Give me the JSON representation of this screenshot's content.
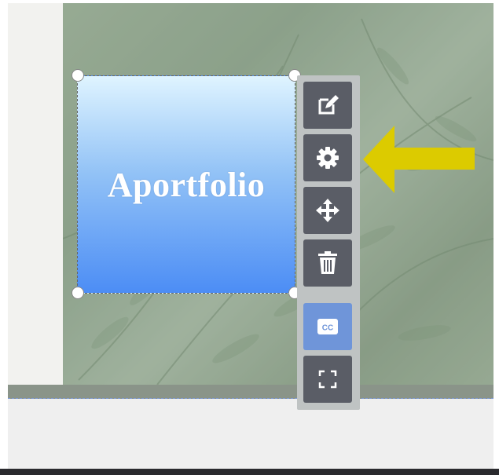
{
  "block": {
    "title": "Aportfolio"
  },
  "toolbar": {
    "tools": [
      {
        "name": "edit",
        "icon": "edit-icon"
      },
      {
        "name": "settings",
        "icon": "gear-icon"
      },
      {
        "name": "move",
        "icon": "move-icon"
      },
      {
        "name": "delete",
        "icon": "trash-icon"
      }
    ],
    "secondary": [
      {
        "name": "captions",
        "icon": "cc-icon",
        "label": "CC"
      },
      {
        "name": "fullscreen",
        "icon": "fullscreen-icon"
      }
    ]
  },
  "colors": {
    "annotation_arrow": "#dccb00",
    "tool_bg": "#5a5d66",
    "tool_active_bg": "#6f95d9",
    "block_gradient_top": "#dff4ff",
    "block_gradient_bottom": "#4c8df5"
  }
}
